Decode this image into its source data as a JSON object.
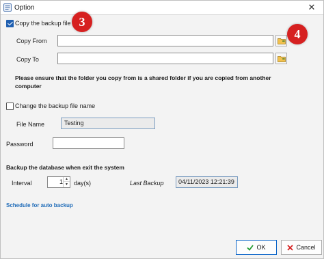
{
  "window": {
    "title": "Option"
  },
  "copy_backup": {
    "checkbox_label": "Copy the backup file",
    "checked": true,
    "copy_from_label": "Copy From",
    "copy_from_value": "",
    "copy_to_label": "Copy To",
    "copy_to_value": "",
    "note": "Please ensure that the folder you copy from is a shared folder if you are copied from another computer"
  },
  "change_name": {
    "checkbox_label": "Change the backup file name",
    "checked": false,
    "file_name_label": "File Name",
    "file_name_value": "Testing"
  },
  "password": {
    "label": "Password",
    "value": ""
  },
  "backup_on_exit": {
    "heading": "Backup the database when exit the system",
    "interval_label": "Interval",
    "interval_value": "1",
    "interval_unit": "day(s)",
    "last_backup_label": "Last Backup",
    "last_backup_value": "04/11/2023 12:21:39"
  },
  "schedule_link": "Schedule for auto backup",
  "badges": {
    "copy_badge": "3",
    "folder_badge": "4"
  },
  "buttons": {
    "ok": "OK",
    "cancel": "Cancel"
  },
  "colors": {
    "accent": "#1f5fb0",
    "badge": "#d62020",
    "link": "#1e6bb8"
  },
  "icons": [
    "app-icon",
    "close-icon",
    "folder-icon",
    "ok-check-icon",
    "cancel-x-icon"
  ]
}
